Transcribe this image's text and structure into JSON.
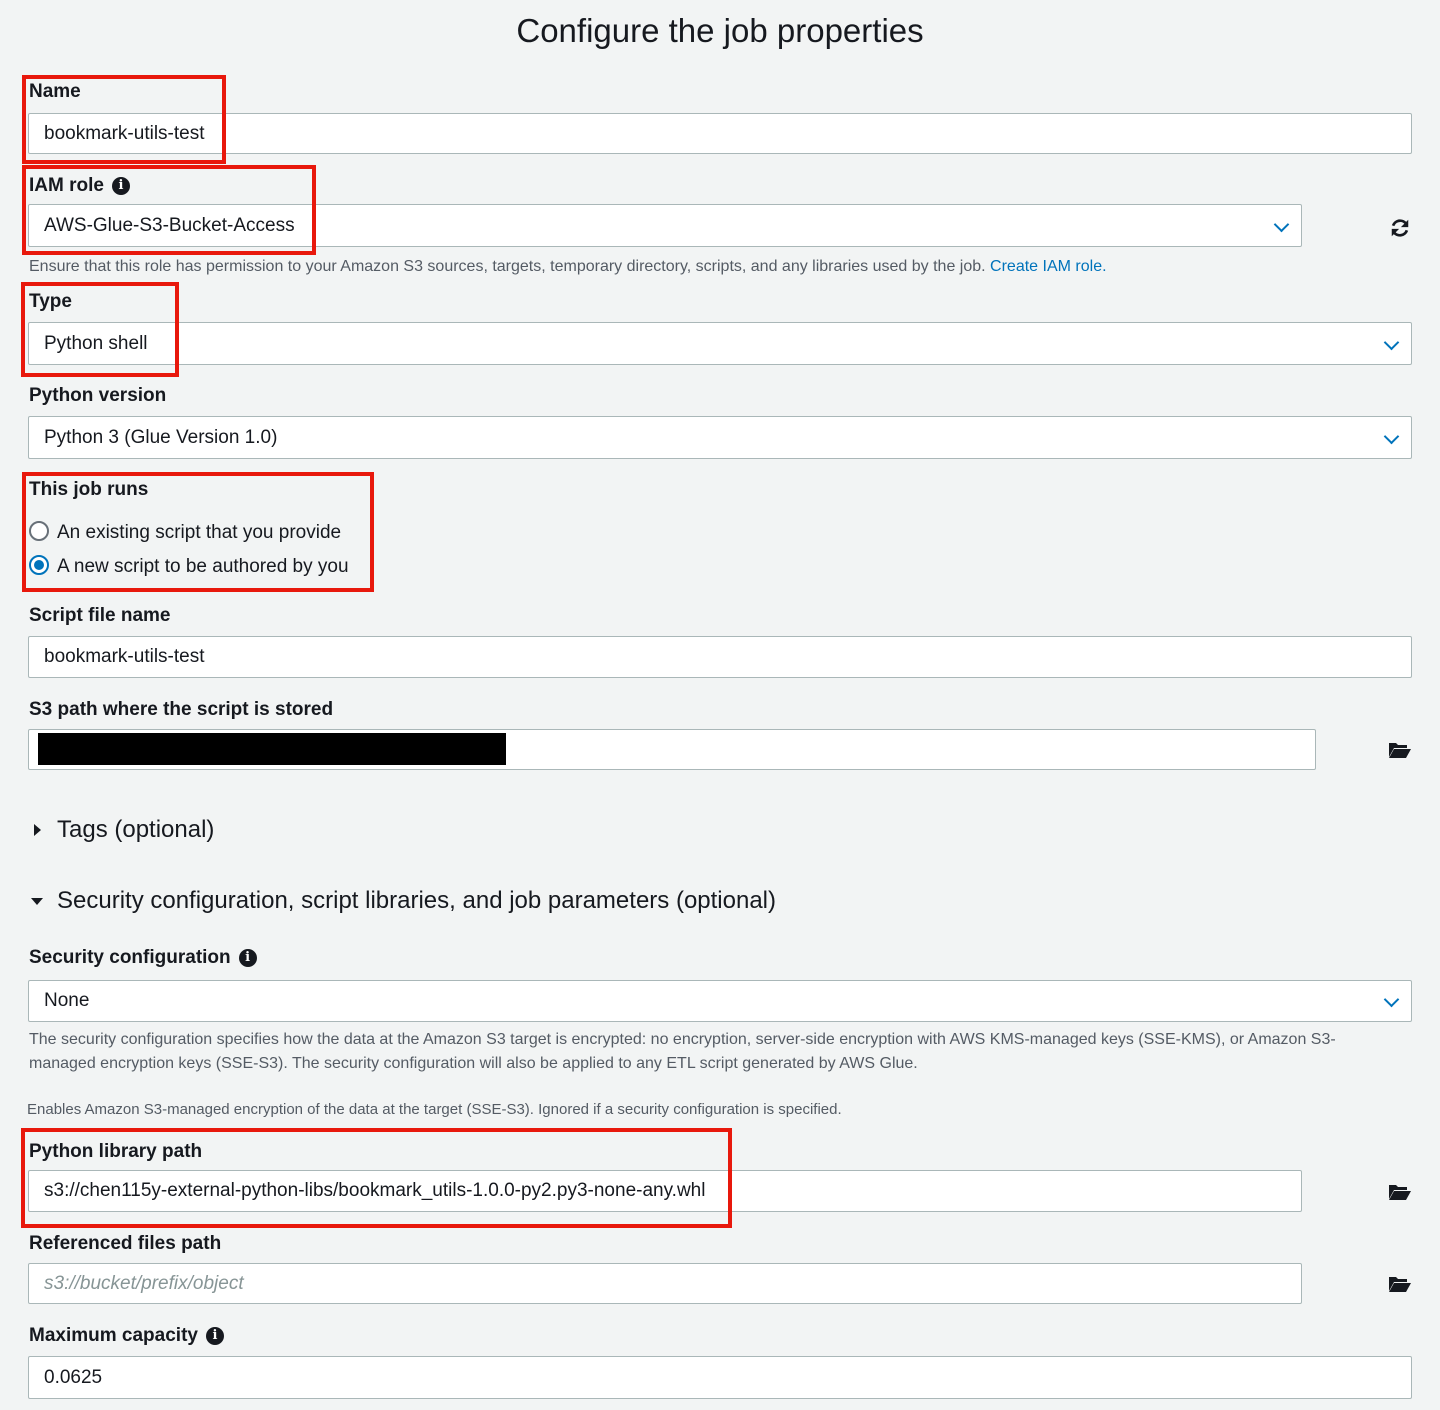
{
  "page": {
    "title": "Configure the job properties"
  },
  "name": {
    "label": "Name",
    "value": "bookmark-utils-test"
  },
  "iam_role": {
    "label": "IAM role",
    "value": "AWS-Glue-S3-Bucket-Access",
    "hint": "Ensure that this role has permission to your Amazon S3 sources, targets, temporary directory, scripts, and any libraries used by the job.",
    "link": "Create IAM role."
  },
  "type": {
    "label": "Type",
    "value": "Python shell"
  },
  "python_version": {
    "label": "Python version",
    "value": "Python 3 (Glue Version 1.0)"
  },
  "job_runs": {
    "label": "This job runs",
    "options": [
      "An existing script that you provide",
      "A new script to be authored by you"
    ],
    "selected": "A new script to be authored by you"
  },
  "script_file_name": {
    "label": "Script file name",
    "value": "bookmark-utils-test"
  },
  "s3_path": {
    "label": "S3 path where the script is stored"
  },
  "tags": {
    "label": "Tags (optional)"
  },
  "security_section": {
    "label": "Security configuration, script libraries, and job parameters (optional)"
  },
  "security_configuration": {
    "label": "Security configuration",
    "value": "None",
    "hint_line1": "The security configuration specifies how the data at the Amazon S3 target is encrypted: no encryption, server-side encryption with AWS KMS-managed keys (SSE-KMS), or Amazon S3-",
    "hint_line2": "managed encryption keys (SSE-S3). The security configuration will also be applied to any ETL script generated by AWS Glue."
  },
  "sse_note": "Enables Amazon S3-managed encryption of the data at the target (SSE-S3). Ignored if a security configuration is specified.",
  "python_library_path": {
    "label": "Python library path",
    "value": "s3://chen115y-external-python-libs/bookmark_utils-1.0.0-py2.py3-none-any.whl"
  },
  "referenced_files_path": {
    "label": "Referenced files path",
    "placeholder": "s3://bucket/prefix/object"
  },
  "maximum_capacity": {
    "label": "Maximum capacity",
    "value": "0.0625"
  },
  "icons": {
    "info": "info-icon",
    "refresh": "refresh-icon",
    "folder": "folder-open-icon",
    "chevron": "chevron-down-icon"
  },
  "colors": {
    "accent": "#0073bb",
    "highlight": "#e8180c",
    "background": "#f2f4f4"
  }
}
